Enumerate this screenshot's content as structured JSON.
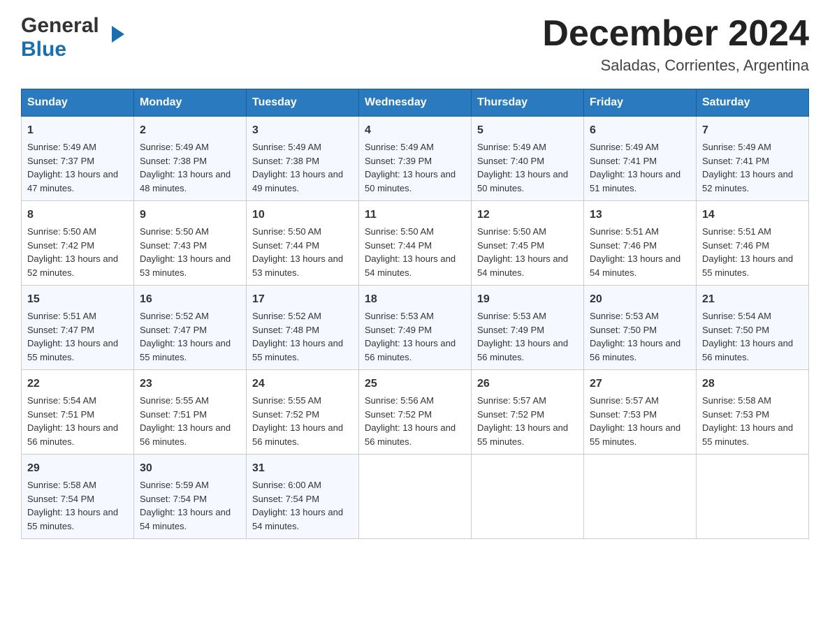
{
  "logo": {
    "general": "General",
    "blue": "Blue",
    "arrow": "▶"
  },
  "title": "December 2024",
  "location": "Saladas, Corrientes, Argentina",
  "weekdays": [
    "Sunday",
    "Monday",
    "Tuesday",
    "Wednesday",
    "Thursday",
    "Friday",
    "Saturday"
  ],
  "weeks": [
    [
      {
        "day": "1",
        "sunrise": "5:49 AM",
        "sunset": "7:37 PM",
        "daylight": "13 hours and 47 minutes."
      },
      {
        "day": "2",
        "sunrise": "5:49 AM",
        "sunset": "7:38 PM",
        "daylight": "13 hours and 48 minutes."
      },
      {
        "day": "3",
        "sunrise": "5:49 AM",
        "sunset": "7:38 PM",
        "daylight": "13 hours and 49 minutes."
      },
      {
        "day": "4",
        "sunrise": "5:49 AM",
        "sunset": "7:39 PM",
        "daylight": "13 hours and 50 minutes."
      },
      {
        "day": "5",
        "sunrise": "5:49 AM",
        "sunset": "7:40 PM",
        "daylight": "13 hours and 50 minutes."
      },
      {
        "day": "6",
        "sunrise": "5:49 AM",
        "sunset": "7:41 PM",
        "daylight": "13 hours and 51 minutes."
      },
      {
        "day": "7",
        "sunrise": "5:49 AM",
        "sunset": "7:41 PM",
        "daylight": "13 hours and 52 minutes."
      }
    ],
    [
      {
        "day": "8",
        "sunrise": "5:50 AM",
        "sunset": "7:42 PM",
        "daylight": "13 hours and 52 minutes."
      },
      {
        "day": "9",
        "sunrise": "5:50 AM",
        "sunset": "7:43 PM",
        "daylight": "13 hours and 53 minutes."
      },
      {
        "day": "10",
        "sunrise": "5:50 AM",
        "sunset": "7:44 PM",
        "daylight": "13 hours and 53 minutes."
      },
      {
        "day": "11",
        "sunrise": "5:50 AM",
        "sunset": "7:44 PM",
        "daylight": "13 hours and 54 minutes."
      },
      {
        "day": "12",
        "sunrise": "5:50 AM",
        "sunset": "7:45 PM",
        "daylight": "13 hours and 54 minutes."
      },
      {
        "day": "13",
        "sunrise": "5:51 AM",
        "sunset": "7:46 PM",
        "daylight": "13 hours and 54 minutes."
      },
      {
        "day": "14",
        "sunrise": "5:51 AM",
        "sunset": "7:46 PM",
        "daylight": "13 hours and 55 minutes."
      }
    ],
    [
      {
        "day": "15",
        "sunrise": "5:51 AM",
        "sunset": "7:47 PM",
        "daylight": "13 hours and 55 minutes."
      },
      {
        "day": "16",
        "sunrise": "5:52 AM",
        "sunset": "7:47 PM",
        "daylight": "13 hours and 55 minutes."
      },
      {
        "day": "17",
        "sunrise": "5:52 AM",
        "sunset": "7:48 PM",
        "daylight": "13 hours and 55 minutes."
      },
      {
        "day": "18",
        "sunrise": "5:53 AM",
        "sunset": "7:49 PM",
        "daylight": "13 hours and 56 minutes."
      },
      {
        "day": "19",
        "sunrise": "5:53 AM",
        "sunset": "7:49 PM",
        "daylight": "13 hours and 56 minutes."
      },
      {
        "day": "20",
        "sunrise": "5:53 AM",
        "sunset": "7:50 PM",
        "daylight": "13 hours and 56 minutes."
      },
      {
        "day": "21",
        "sunrise": "5:54 AM",
        "sunset": "7:50 PM",
        "daylight": "13 hours and 56 minutes."
      }
    ],
    [
      {
        "day": "22",
        "sunrise": "5:54 AM",
        "sunset": "7:51 PM",
        "daylight": "13 hours and 56 minutes."
      },
      {
        "day": "23",
        "sunrise": "5:55 AM",
        "sunset": "7:51 PM",
        "daylight": "13 hours and 56 minutes."
      },
      {
        "day": "24",
        "sunrise": "5:55 AM",
        "sunset": "7:52 PM",
        "daylight": "13 hours and 56 minutes."
      },
      {
        "day": "25",
        "sunrise": "5:56 AM",
        "sunset": "7:52 PM",
        "daylight": "13 hours and 56 minutes."
      },
      {
        "day": "26",
        "sunrise": "5:57 AM",
        "sunset": "7:52 PM",
        "daylight": "13 hours and 55 minutes."
      },
      {
        "day": "27",
        "sunrise": "5:57 AM",
        "sunset": "7:53 PM",
        "daylight": "13 hours and 55 minutes."
      },
      {
        "day": "28",
        "sunrise": "5:58 AM",
        "sunset": "7:53 PM",
        "daylight": "13 hours and 55 minutes."
      }
    ],
    [
      {
        "day": "29",
        "sunrise": "5:58 AM",
        "sunset": "7:54 PM",
        "daylight": "13 hours and 55 minutes."
      },
      {
        "day": "30",
        "sunrise": "5:59 AM",
        "sunset": "7:54 PM",
        "daylight": "13 hours and 54 minutes."
      },
      {
        "day": "31",
        "sunrise": "6:00 AM",
        "sunset": "7:54 PM",
        "daylight": "13 hours and 54 minutes."
      },
      null,
      null,
      null,
      null
    ]
  ],
  "labels": {
    "sunrise_prefix": "Sunrise: ",
    "sunset_prefix": "Sunset: ",
    "daylight_prefix": "Daylight: "
  }
}
